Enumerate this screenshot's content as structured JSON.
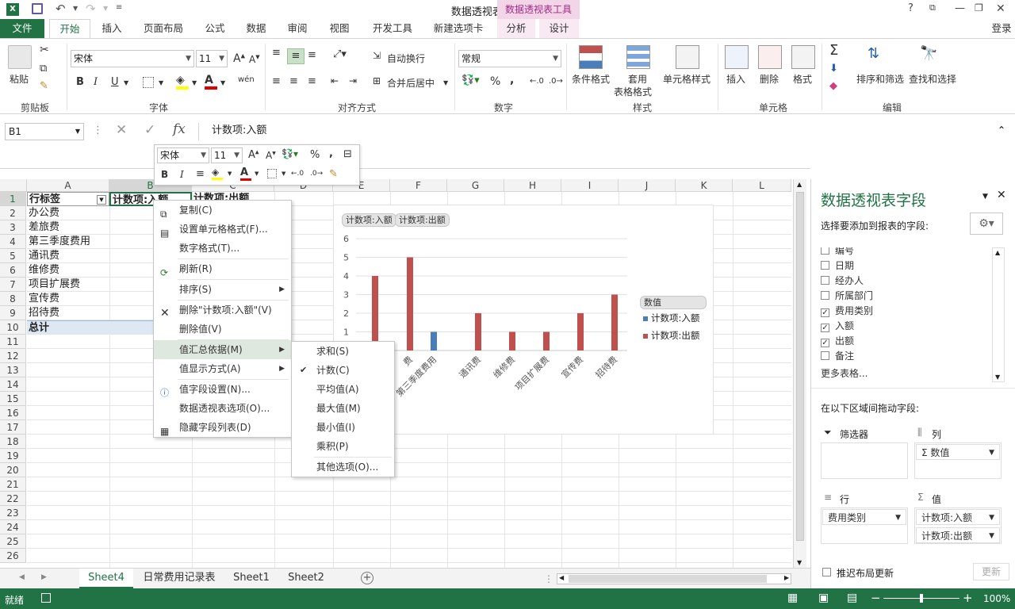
{
  "window": {
    "title": "数据透视表.xlsx - Excel",
    "context_tool": "数据透视表工具",
    "help": "?",
    "login": "登录"
  },
  "tabs": [
    "文件",
    "开始",
    "插入",
    "页面布局",
    "公式",
    "数据",
    "审阅",
    "视图",
    "开发工具",
    "新建选项卡",
    "分析",
    "设计"
  ],
  "ribbon": {
    "paste": "粘贴",
    "clipboard": "剪贴板",
    "font_name": "宋体",
    "font_size": "11",
    "font_group": "字体",
    "bold": "B",
    "italic": "I",
    "underline": "U",
    "phonetic": "wén",
    "wrap": "自动换行",
    "merge": "合并后居中",
    "align_group": "对齐方式",
    "number_format": "常规",
    "percent": "%",
    "comma": ",",
    "number_group": "数字",
    "cond_format": "条件格式",
    "table_format_1": "套用",
    "table_format_2": "表格格式",
    "cell_style": "单元格样式",
    "style_group": "样式",
    "insert": "插入",
    "delete": "删除",
    "format": "格式",
    "cells_group": "单元格",
    "sort_filter": "排序和筛选",
    "find_select": "查找和选择",
    "edit_group": "编辑"
  },
  "formula_bar": {
    "name_box": "B1",
    "fx": "fx",
    "formula": "计数项:入额"
  },
  "columns": [
    "A",
    "B",
    "C",
    "D",
    "E",
    "F",
    "G",
    "H",
    "I",
    "J",
    "K",
    "L"
  ],
  "rows": [
    "1",
    "2",
    "3",
    "4",
    "5",
    "6",
    "7",
    "8",
    "9",
    "10",
    "11",
    "12",
    "13",
    "14",
    "15",
    "16",
    "17",
    "18",
    "19",
    "20",
    "21",
    "22",
    "23",
    "24",
    "25",
    "26"
  ],
  "cells": {
    "a1": "行标签",
    "b1": "计数项:入额",
    "c1": "计数项:出额",
    "a_items": [
      "办公费",
      "差旅费",
      "第三季度费用",
      "通讯费",
      "维修费",
      "项目扩展费",
      "宣传费",
      "招待费"
    ],
    "total": "总计"
  },
  "mini_toolbar": {
    "font": "宋体",
    "size": "11",
    "percent": "%",
    "comma": ",",
    "bold": "B",
    "italic": "I"
  },
  "context_menu": {
    "items": [
      "复制(C)",
      "设置单元格格式(F)...",
      "数字格式(T)...",
      "刷新(R)",
      "排序(S)",
      "删除\"计数项:入额\"(V)",
      "删除值(V)",
      "值汇总依据(M)",
      "值显示方式(A)",
      "值字段设置(N)...",
      "数据透视表选项(O)...",
      "隐藏字段列表(D)"
    ],
    "submenu": [
      "求和(S)",
      "计数(C)",
      "平均值(A)",
      "最大值(M)",
      "最小值(I)",
      "乘积(P)",
      "其他选项(O)..."
    ]
  },
  "chart_data": {
    "type": "bar",
    "field_buttons": [
      "计数项:入额",
      "计数项:出额"
    ],
    "legend_title": "数值",
    "categories": [
      "费",
      "第三季度费用",
      "通讯费",
      "维修费",
      "项目扩展费",
      "宣传费",
      "招待费"
    ],
    "series": [
      {
        "name": "计数项:入额",
        "color": "#4a7ebb",
        "values": [
          null,
          1,
          null,
          null,
          null,
          null,
          null
        ]
      },
      {
        "name": "计数项:出额",
        "color": "#c0504d",
        "values": [
          5,
          null,
          2,
          1,
          1,
          2,
          3
        ]
      }
    ],
    "extra_bar_value": 4,
    "yticks": [
      "6",
      "5",
      "4",
      "3",
      "2",
      "1"
    ],
    "ylim": [
      0,
      6
    ]
  },
  "pane": {
    "title": "数据透视表字段",
    "choose": "选择要添加到报表的字段:",
    "fields": [
      {
        "label": "编号",
        "checked": false
      },
      {
        "label": "日期",
        "checked": false
      },
      {
        "label": "经办人",
        "checked": false
      },
      {
        "label": "所属部门",
        "checked": false
      },
      {
        "label": "费用类别",
        "checked": true
      },
      {
        "label": "入额",
        "checked": true
      },
      {
        "label": "出额",
        "checked": true
      },
      {
        "label": "备注",
        "checked": false
      }
    ],
    "more_tables": "更多表格...",
    "drag_hint": "在以下区域间拖动字段:",
    "filters": "筛选器",
    "columns": "列",
    "columns_value": "Σ 数值",
    "rows": "行",
    "rows_value": "费用类别",
    "values": "值",
    "values_1": "计数项:入额",
    "values_2": "计数项:出额",
    "defer": "推迟布局更新",
    "update": "更新"
  },
  "sheets": [
    "Sheet4",
    "日常费用记录表",
    "Sheet1",
    "Sheet2"
  ],
  "status": {
    "ready": "就绪",
    "zoom": "100%"
  }
}
